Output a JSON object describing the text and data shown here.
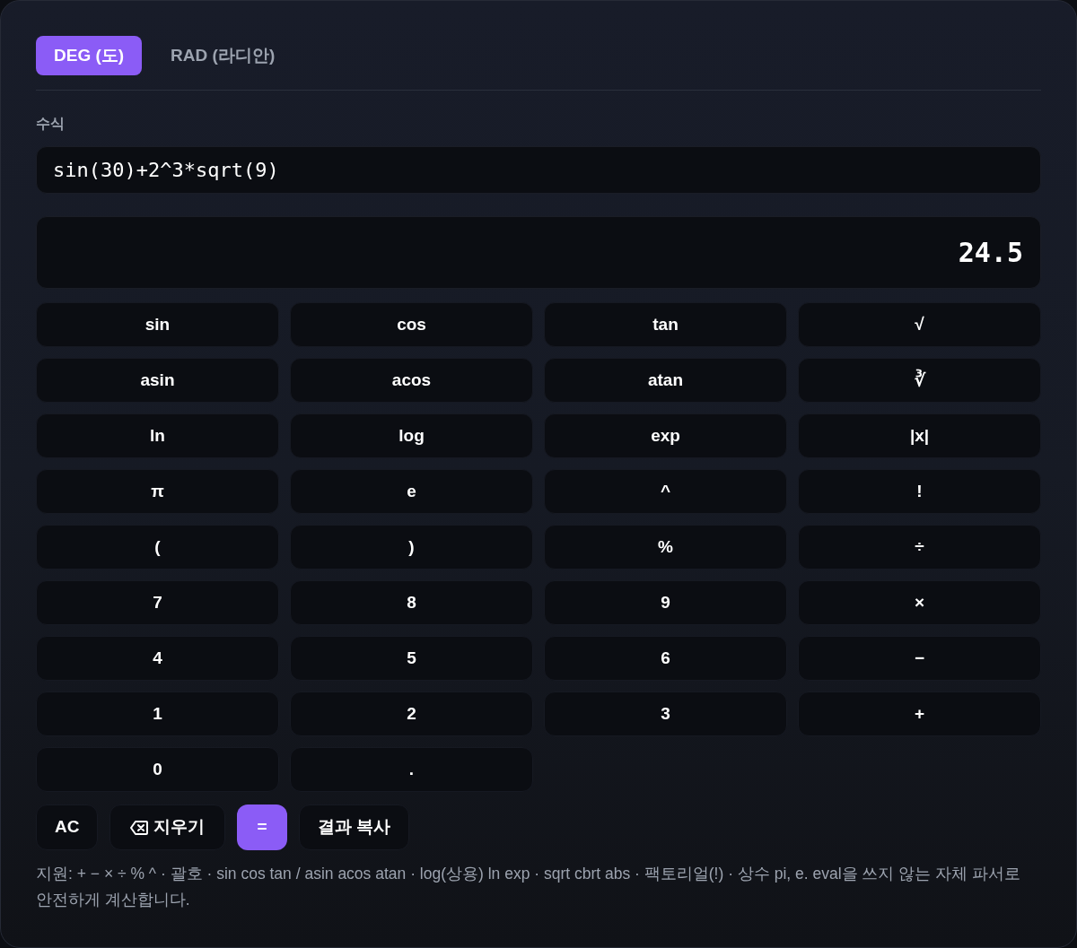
{
  "tabs": [
    {
      "label": "DEG (도)",
      "selected": true
    },
    {
      "label": "RAD (라디안)",
      "selected": false
    }
  ],
  "expression": {
    "label": "수식",
    "value": "sin(30)+2^3*sqrt(9)"
  },
  "result": "24.5",
  "keypad": [
    "sin",
    "cos",
    "tan",
    "√",
    "asin",
    "acos",
    "atan",
    "∛",
    "ln",
    "log",
    "exp",
    "|x|",
    "π",
    "e",
    "^",
    "!",
    "(",
    ")",
    "%",
    "÷",
    "7",
    "8",
    "9",
    "×",
    "4",
    "5",
    "6",
    "−",
    "1",
    "2",
    "3",
    "+",
    "0",
    "."
  ],
  "actions": [
    {
      "label": "AC",
      "kind": "plain"
    },
    {
      "label": "지우기",
      "kind": "backspace"
    },
    {
      "label": "=",
      "kind": "primary"
    },
    {
      "label": "결과 복사",
      "kind": "plain"
    }
  ],
  "help": "지원: + − × ÷ % ^ · 괄호 · sin cos tan / asin acos atan · log(상용) ln exp · sqrt cbrt abs · 팩토리얼(!) · 상수 pi, e. eval을 쓰지 않는 자체 파서로 안전하게 계산합니다."
}
